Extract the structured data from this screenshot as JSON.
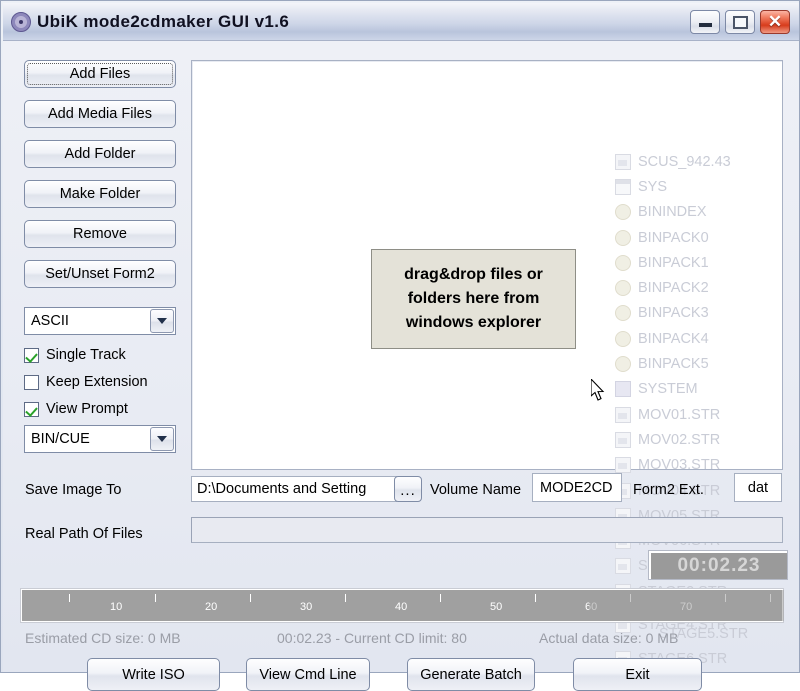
{
  "window": {
    "title": "UbiK mode2cdmaker GUI v1.6",
    "icon": "cd-disc-icon",
    "controls": {
      "minimize": "minimize-button",
      "maximize": "maximize-button",
      "close_glyph": "✕"
    }
  },
  "sidebar": {
    "buttons": [
      {
        "label": "Add Files",
        "name": "add-files-button",
        "focused": true
      },
      {
        "label": "Add Media Files",
        "name": "add-media-files-button",
        "focused": false
      },
      {
        "label": "Add Folder",
        "name": "add-folder-button",
        "focused": false
      },
      {
        "label": "Make Folder",
        "name": "make-folder-button",
        "focused": false
      },
      {
        "label": "Remove",
        "name": "remove-button",
        "focused": false
      },
      {
        "label": "Set/Unset Form2",
        "name": "set-unset-form2-button",
        "focused": false
      }
    ],
    "charset_combo": {
      "value": "ASCII",
      "name": "charset-combo"
    },
    "checkboxes": [
      {
        "label": "Single Track",
        "checked": true,
        "name": "single-track-checkbox"
      },
      {
        "label": "Keep Extension",
        "checked": false,
        "name": "keep-extension-checkbox"
      },
      {
        "label": "View Prompt",
        "checked": true,
        "name": "view-prompt-checkbox"
      }
    ],
    "format_combo": {
      "value": "BIN/CUE",
      "name": "output-format-combo"
    }
  },
  "drop_panel": {
    "hint_lines": [
      "drag&drop files or",
      "folders here from",
      "windows explorer"
    ]
  },
  "ghost_list": {
    "items": [
      {
        "label": "SCUS_942.43",
        "icon": "file-icon"
      },
      {
        "label": "SYS",
        "icon": "window-icon"
      },
      {
        "label": "BININDEX",
        "icon": "disc-icon"
      },
      {
        "label": "BINPACK0",
        "icon": "disc-icon"
      },
      {
        "label": "BINPACK1",
        "icon": "disc-icon"
      },
      {
        "label": "BINPACK2",
        "icon": "disc-icon"
      },
      {
        "label": "BINPACK3",
        "icon": "disc-icon"
      },
      {
        "label": "BINPACK4",
        "icon": "disc-icon"
      },
      {
        "label": "BINPACK5",
        "icon": "disc-icon"
      },
      {
        "label": "SYSTEM",
        "icon": "system-icon"
      },
      {
        "label": "MOV01.STR",
        "icon": "file-icon"
      },
      {
        "label": "MOV02.STR",
        "icon": "file-icon"
      },
      {
        "label": "MOV03.STR",
        "icon": "file-icon"
      },
      {
        "label": "MOV04.STR",
        "icon": "file-icon"
      },
      {
        "label": "MOV05.STR",
        "icon": "file-icon"
      },
      {
        "label": "MOV06.STR",
        "icon": "file-icon"
      },
      {
        "label": "STAGE1.STR",
        "icon": "file-icon"
      },
      {
        "label": "STAGE2.STR",
        "icon": "file-icon"
      },
      {
        "label": "STAGE3.STR",
        "icon": "file-icon"
      },
      {
        "label": "STAGE4.STR",
        "icon": "file-icon"
      },
      {
        "label": "STAGE5.STR",
        "icon": "file-icon"
      },
      {
        "label": "STAGE6.STR",
        "icon": "file-icon"
      }
    ]
  },
  "form": {
    "save_image_label": "Save Image To",
    "save_image_value": "D:\\Documents and Setting",
    "browse_label": "...",
    "volume_name_label": "Volume Name",
    "volume_name_value": "MODE2CD",
    "form2_ext_label": "Form2 Ext.",
    "form2_ext_value": "dat",
    "real_path_label": "Real Path Of Files",
    "real_path_value": ""
  },
  "progress": {
    "time": "00:02.23"
  },
  "ruler": {
    "ticks": [
      10,
      20,
      30,
      40,
      50,
      60,
      70
    ],
    "max": 80
  },
  "status": {
    "estimated": "Estimated CD size: 0 MB",
    "current": "00:02.23 - Current CD limit: 80",
    "actual": "Actual data size: 0 MB"
  },
  "bottom_buttons": [
    {
      "label": "Write ISO",
      "name": "write-iso-button"
    },
    {
      "label": "View Cmd Line",
      "name": "view-cmd-line-button"
    },
    {
      "label": "Generate Batch",
      "name": "generate-batch-button"
    },
    {
      "label": "Exit",
      "name": "exit-button"
    }
  ]
}
